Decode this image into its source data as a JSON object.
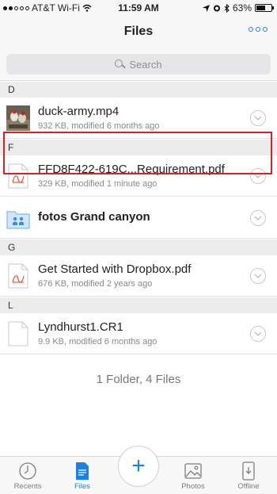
{
  "status_bar": {
    "carrier": "AT&T Wi-Fi",
    "time": "11:59 AM",
    "battery": "63%",
    "battery_level": 0.63
  },
  "nav": {
    "title": "Files",
    "more_icon": "more-icon"
  },
  "search": {
    "placeholder": "Search"
  },
  "sections": [
    {
      "letter": "D",
      "items": [
        {
          "name": "duck-army.mp4",
          "meta": "932 KB, modified 6 months ago",
          "icon": "video-thumbnail"
        }
      ]
    },
    {
      "letter": "F",
      "items": [
        {
          "name": "FFD8F422-619C...Requirement.pdf",
          "meta": "329 KB, modified 1 minute ago",
          "icon": "pdf-icon"
        },
        {
          "name": "fotos Grand canyon",
          "meta": "",
          "icon": "shared-folder-icon"
        }
      ]
    },
    {
      "letter": "G",
      "items": [
        {
          "name": "Get Started with Dropbox.pdf",
          "meta": "676 KB, modified 2 years ago",
          "icon": "pdf-icon"
        }
      ]
    },
    {
      "letter": "L",
      "items": [
        {
          "name": "Lyndhurst1.CR1",
          "meta": "9.9 KB, modified 6 months ago",
          "icon": "document-icon"
        }
      ]
    }
  ],
  "summary": "1 Folder, 4 Files",
  "tabs": [
    {
      "label": "Recents",
      "icon": "clock-icon"
    },
    {
      "label": "Files",
      "icon": "file-icon"
    },
    {
      "label": "Photos",
      "icon": "photo-icon"
    },
    {
      "label": "Offline",
      "icon": "phone-download-icon"
    }
  ],
  "colors": {
    "accent": "#1a82e2",
    "highlight": "#d62222"
  }
}
